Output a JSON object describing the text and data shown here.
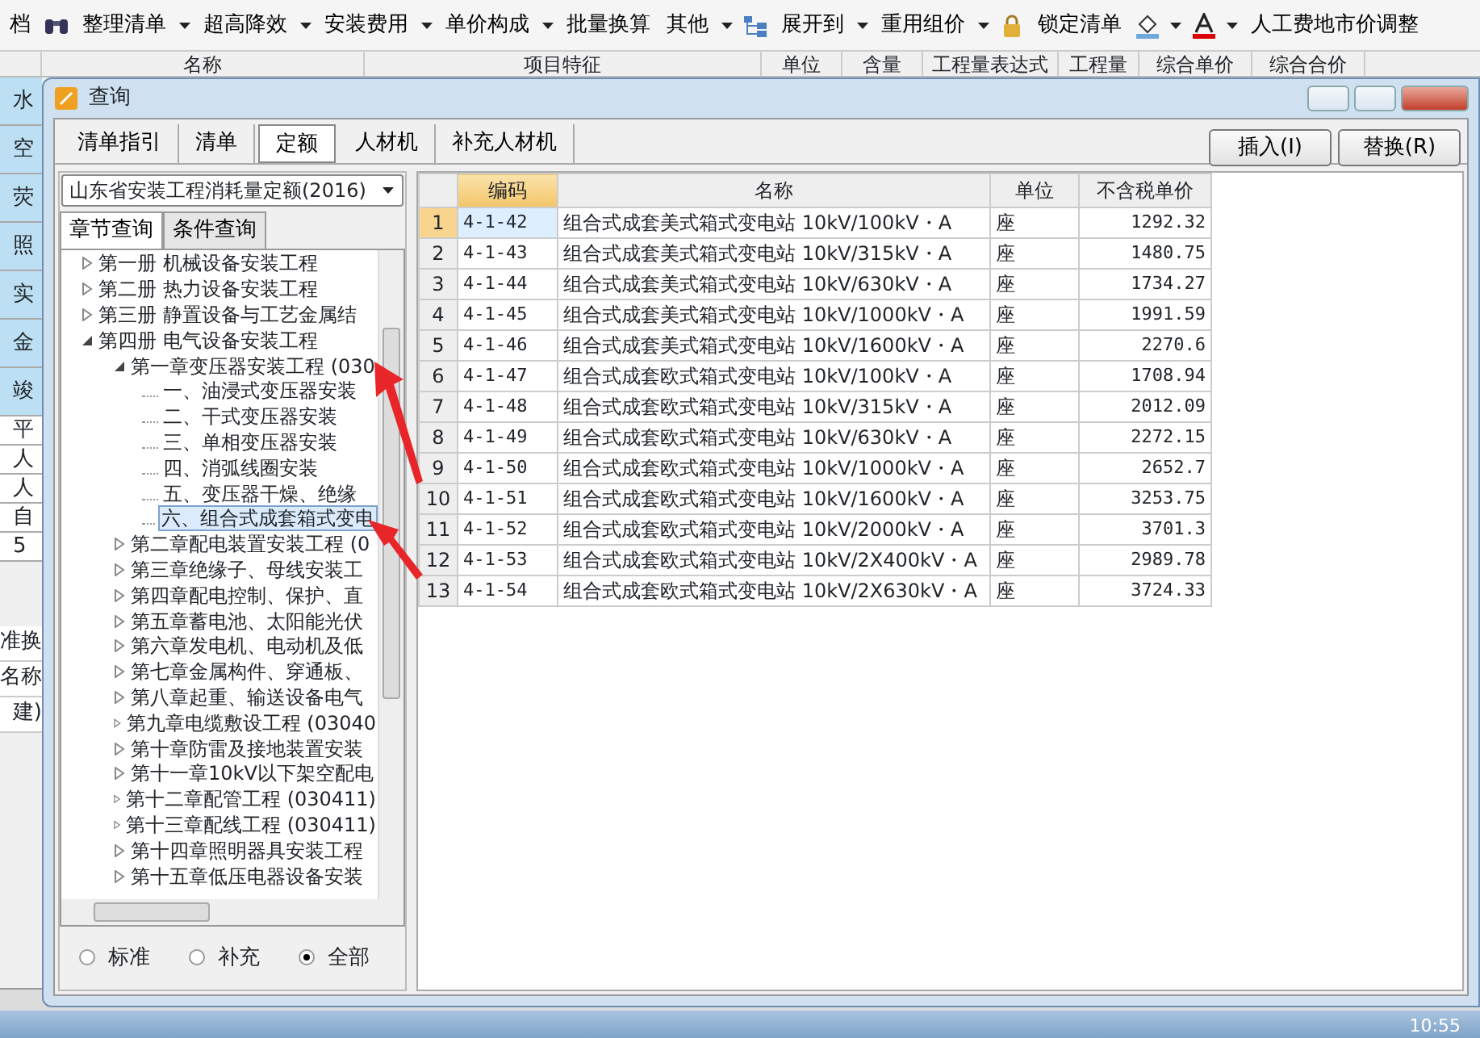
{
  "toolbar": [
    {
      "kind": "text",
      "label": "档"
    },
    {
      "kind": "search"
    },
    {
      "kind": "menu",
      "label": "整理清单"
    },
    {
      "kind": "menu",
      "label": "超高降效"
    },
    {
      "kind": "menu",
      "label": "安装费用"
    },
    {
      "kind": "menu",
      "label": "单价构成"
    },
    {
      "kind": "text",
      "label": "批量换算"
    },
    {
      "kind": "menu",
      "label": "其他"
    },
    {
      "kind": "expand",
      "label": "展开到"
    },
    {
      "kind": "menu",
      "label": "重用组价"
    },
    {
      "kind": "lock",
      "label": "锁定清单"
    },
    {
      "kind": "fill"
    },
    {
      "kind": "fontcolor"
    },
    {
      "kind": "text",
      "label": "人工费地市价调整"
    }
  ],
  "grid_header": [
    "名称",
    "项目特征",
    "单位",
    "含量",
    "工程量表达式",
    "工程量",
    "综合单价",
    "综合合价"
  ],
  "grid_rows": [
    {
      "text": "水",
      "highlight": true
    },
    {
      "text": "空",
      "highlight": true
    },
    {
      "text": "荧",
      "highlight": true
    },
    {
      "text": "照",
      "highlight": true
    },
    {
      "text": "实",
      "highlight": true
    },
    {
      "text": "金",
      "highlight": true
    },
    {
      "text": "竣",
      "highlight": true
    },
    {
      "text": "平",
      "highlight": false
    },
    {
      "text": "人",
      "highlight": false
    },
    {
      "text": "人",
      "highlight": false
    },
    {
      "text": "自",
      "highlight": false
    },
    {
      "text": "5",
      "highlight": false
    }
  ],
  "lower_rows": [
    "准换",
    "名称",
    "建)"
  ],
  "dialog": {
    "title": "查询",
    "tabs": [
      {
        "label": "清单指引",
        "selected": false
      },
      {
        "label": "清单",
        "selected": false
      },
      {
        "label": "定额",
        "selected": true
      },
      {
        "label": "人材机",
        "selected": false
      },
      {
        "label": "补充人材机",
        "selected": false
      }
    ],
    "buttons": [
      "插入(I)",
      "替换(R)"
    ],
    "library": "山东省安装工程消耗量定额(2016)",
    "search_tabs": [
      {
        "label": "章节查询",
        "selected": true
      },
      {
        "label": "条件查询",
        "selected": false
      }
    ],
    "tree": [
      {
        "label": "第一册 机械设备安装工程",
        "expanded": false,
        "selected": false
      },
      {
        "label": "第二册 热力设备安装工程",
        "expanded": false,
        "selected": false
      },
      {
        "label": "第三册 静置设备与工艺金属结",
        "expanded": false,
        "selected": false
      },
      {
        "label": "第四册 电气设备安装工程",
        "expanded": true,
        "selected": false,
        "children": [
          {
            "label": "第一章变压器安装工程 (030",
            "expanded": true,
            "selected": false,
            "children": [
              {
                "label": "一、油浸式变压器安装",
                "selected": false
              },
              {
                "label": "二、干式变压器安装",
                "selected": false
              },
              {
                "label": "三、单相变压器安装",
                "selected": false
              },
              {
                "label": "四、消弧线圈安装",
                "selected": false
              },
              {
                "label": "五、变压器干燥、绝缘",
                "selected": false
              },
              {
                "label": "六、组合式成套箱式变电",
                "selected": true
              }
            ]
          },
          {
            "label": "第二章配电装置安装工程 (0",
            "expanded": false,
            "selected": false
          },
          {
            "label": "第三章绝缘子、母线安装工",
            "expanded": false,
            "selected": false
          },
          {
            "label": "第四章配电控制、保护、直",
            "expanded": false,
            "selected": false
          },
          {
            "label": "第五章蓄电池、太阳能光伏",
            "expanded": false,
            "selected": false
          },
          {
            "label": "第六章发电机、电动机及低",
            "expanded": false,
            "selected": false
          },
          {
            "label": "第七章金属构件、穿通板、",
            "expanded": false,
            "selected": false
          },
          {
            "label": "第八章起重、输送设备电气",
            "expanded": false,
            "selected": false
          },
          {
            "label": "第九章电缆敷设工程 (03040",
            "expanded": false,
            "selected": false
          },
          {
            "label": "第十章防雷及接地装置安装",
            "expanded": false,
            "selected": false
          },
          {
            "label": "第十一章10kV以下架空配电",
            "expanded": false,
            "selected": false
          },
          {
            "label": "第十二章配管工程 (030411)",
            "expanded": false,
            "selected": false
          },
          {
            "label": "第十三章配线工程 (030411)",
            "expanded": false,
            "selected": false
          },
          {
            "label": "第十四章照明器具安装工程",
            "expanded": false,
            "selected": false
          },
          {
            "label": "第十五章低压电器设备安装",
            "expanded": false,
            "selected": false
          }
        ]
      }
    ],
    "scope": [
      {
        "label": "标准",
        "selected": false
      },
      {
        "label": "补充",
        "selected": false
      },
      {
        "label": "全部",
        "selected": true
      }
    ],
    "table": {
      "columns": [
        {
          "label": "编码",
          "selected": true
        },
        {
          "label": "名称",
          "selected": false
        },
        {
          "label": "单位",
          "selected": false
        },
        {
          "label": "不含税单价",
          "selected": false
        }
      ],
      "rows": [
        {
          "index": "1",
          "code": "4-1-42",
          "name": "组合式成套美式箱式变电站 10kV/100kV・A",
          "unit": "座",
          "price": "1292.32",
          "selected": true
        },
        {
          "index": "2",
          "code": "4-1-43",
          "name": "组合式成套美式箱式变电站 10kV/315kV・A",
          "unit": "座",
          "price": "1480.75",
          "selected": false
        },
        {
          "index": "3",
          "code": "4-1-44",
          "name": "组合式成套美式箱式变电站 10kV/630kV・A",
          "unit": "座",
          "price": "1734.27",
          "selected": false
        },
        {
          "index": "4",
          "code": "4-1-45",
          "name": "组合式成套美式箱式变电站 10kV/1000kV・A",
          "unit": "座",
          "price": "1991.59",
          "selected": false
        },
        {
          "index": "5",
          "code": "4-1-46",
          "name": "组合式成套美式箱式变电站 10kV/1600kV・A",
          "unit": "座",
          "price": "2270.6",
          "selected": false
        },
        {
          "index": "6",
          "code": "4-1-47",
          "name": "组合式成套欧式箱式变电站 10kV/100kV・A",
          "unit": "座",
          "price": "1708.94",
          "selected": false
        },
        {
          "index": "7",
          "code": "4-1-48",
          "name": "组合式成套欧式箱式变电站 10kV/315kV・A",
          "unit": "座",
          "price": "2012.09",
          "selected": false
        },
        {
          "index": "8",
          "code": "4-1-49",
          "name": "组合式成套欧式箱式变电站 10kV/630kV・A",
          "unit": "座",
          "price": "2272.15",
          "selected": false
        },
        {
          "index": "9",
          "code": "4-1-50",
          "name": "组合式成套欧式箱式变电站 10kV/1000kV・A",
          "unit": "座",
          "price": "2652.7",
          "selected": false
        },
        {
          "index": "10",
          "code": "4-1-51",
          "name": "组合式成套欧式箱式变电站 10kV/1600kV・A",
          "unit": "座",
          "price": "3253.75",
          "selected": false
        },
        {
          "index": "11",
          "code": "4-1-52",
          "name": "组合式成套欧式箱式变电站 10kV/2000kV・A",
          "unit": "座",
          "price": "3701.3",
          "selected": false
        },
        {
          "index": "12",
          "code": "4-1-53",
          "name": "组合式成套欧式箱式变电站 10kV/2X400kV・A",
          "unit": "座",
          "price": "2989.78",
          "selected": false
        },
        {
          "index": "13",
          "code": "4-1-54",
          "name": "组合式成套欧式箱式变电站 10kV/2X630kV・A",
          "unit": "座",
          "price": "3724.33",
          "selected": false
        }
      ]
    }
  },
  "taskbar": {
    "clock": "10:55"
  }
}
